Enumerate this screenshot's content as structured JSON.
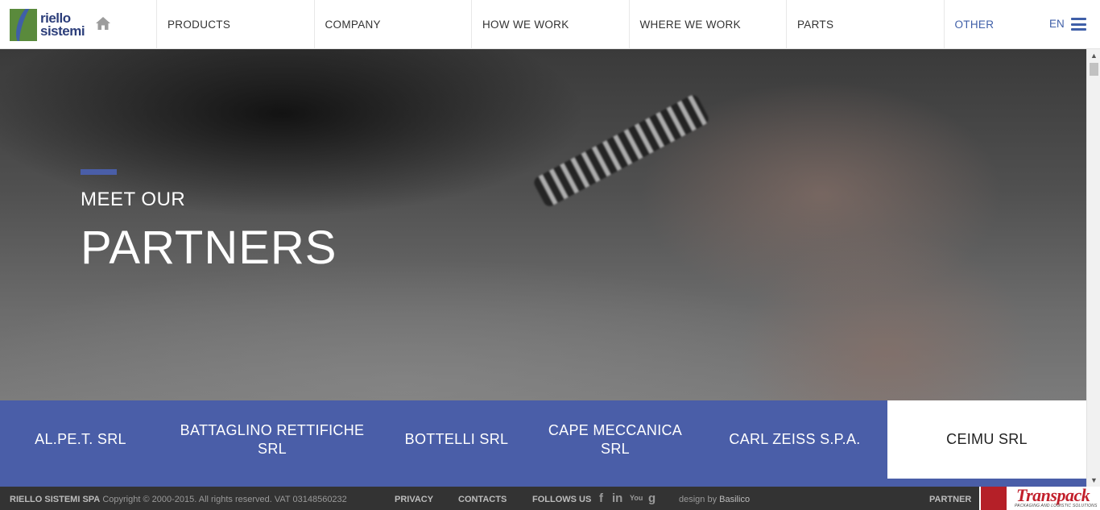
{
  "header": {
    "logo_line1": "riello",
    "logo_line2": "sistemi",
    "home_icon": "home-icon",
    "nav": [
      {
        "label": "PRODUCTS"
      },
      {
        "label": "COMPANY"
      },
      {
        "label": "HOW WE WORK"
      },
      {
        "label": "WHERE WE WORK"
      },
      {
        "label": "PARTS"
      },
      {
        "label": "OTHER"
      }
    ],
    "language": "EN",
    "menu_icon": "hamburger-menu-icon",
    "accent_color": "#3f5fa8"
  },
  "hero": {
    "subtitle": "MEET OUR",
    "title": "PARTNERS"
  },
  "partners": {
    "background_color": "#4a5ea8",
    "items": [
      {
        "name": "AL.PE.T. SRL"
      },
      {
        "name": "BATTAGLINO RETTIFICHE SRL"
      },
      {
        "name": "BOTTELLI SRL"
      },
      {
        "name": "CAPE MECCANICA SRL"
      },
      {
        "name": "CARL ZEISS S.P.A."
      },
      {
        "name": "CEIMU SRL",
        "active": true
      }
    ]
  },
  "footer": {
    "company": "RIELLO SISTEMI SPA",
    "copyright": "Copyright © 2000-2015. All rights reserved. VAT 03148560232",
    "privacy": "PRIVACY",
    "contacts": "CONTACTS",
    "follow": "FOLLOWS US",
    "social": [
      {
        "icon": "facebook-icon",
        "glyph": "f"
      },
      {
        "icon": "linkedin-icon",
        "glyph": "in"
      },
      {
        "icon": "youtube-icon",
        "glyph": "You"
      },
      {
        "icon": "google-plus-icon",
        "glyph": "g"
      }
    ],
    "design_prefix": "design by",
    "design_by": "Basilico",
    "partner_label": "PARTNER",
    "partner_logo_text": "Transpack",
    "partner_logo_tagline": "PACKAGING AND LOGISTIC SOLUTIONS"
  }
}
